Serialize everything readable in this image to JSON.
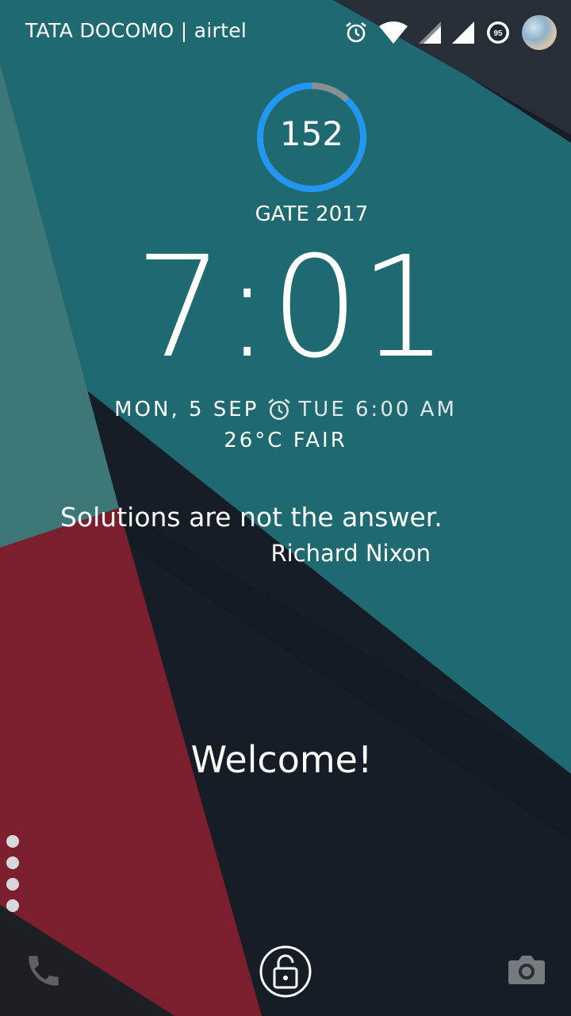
{
  "status_bar": {
    "carrier": "TATA DOCOMO | airtel",
    "battery_level": "95",
    "icons": [
      "alarm-icon",
      "wifi-icon",
      "signal-icon-sim1",
      "signal-icon-sim2",
      "battery-icon",
      "avatar"
    ]
  },
  "countdown": {
    "days_left": "152",
    "event": "GATE 2017",
    "progress": 0.88,
    "ring_color": "#2196f3",
    "track_color": "#8a8f94"
  },
  "clock": {
    "time": "7:01",
    "date": "MON, 5 SEP",
    "next_alarm": "TUE 6:00 AM",
    "weather": "26°C FAIR"
  },
  "quote": {
    "text": "Solutions are not the answer.",
    "author": "Richard Nixon"
  },
  "welcome": "Welcome!",
  "pager": {
    "pages": 4
  },
  "bottom_bar": {
    "left": "phone-icon",
    "center": "lock-icon",
    "right": "camera-icon"
  },
  "colors": {
    "teal": "#1f6970",
    "crimson": "#7b1e2e",
    "navy": "#161d27",
    "light_teal": "#3d7777"
  }
}
